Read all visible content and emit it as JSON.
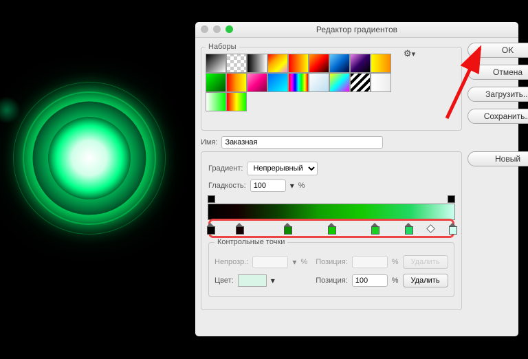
{
  "window": {
    "title": "Редактор градиентов"
  },
  "presets_label": "Наборы",
  "buttons": {
    "ok": "OK",
    "cancel": "Отмена",
    "load": "Загрузить...",
    "save": "Сохранить...",
    "new": "Новый"
  },
  "name": {
    "label": "Имя:",
    "value": "Заказная"
  },
  "gradient": {
    "type_label": "Градиент:",
    "type_value": "Непрерывный",
    "smooth_label": "Гладкость:",
    "smooth_value": "100",
    "chart_data": {
      "type": "gradient",
      "stops": [
        {
          "pos": 0,
          "color": "#000000"
        },
        {
          "pos": 12,
          "color": "#140000"
        },
        {
          "pos": 32,
          "color": "#0f8a00"
        },
        {
          "pos": 50,
          "color": "#14c800"
        },
        {
          "pos": 68,
          "color": "#18d020"
        },
        {
          "pos": 82,
          "color": "#22d862"
        },
        {
          "pos": 100,
          "color": "#cdfef0"
        }
      ],
      "opacity_stops": [
        {
          "pos": 0,
          "opacity": 100
        },
        {
          "pos": 100,
          "opacity": 100
        }
      ]
    }
  },
  "control_points": {
    "legend": "Контрольные точки",
    "opacity_label": "Непрозр.:",
    "position_label": "Позиция:",
    "color_label": "Цвет:",
    "position_value": "100",
    "delete": "Удалить",
    "selected_color": "#d9f5e8"
  },
  "percent": "%",
  "preset_gradients": [
    "linear-gradient(135deg,#000,#fff)",
    "repeating-conic-gradient(#ccc 0 25%,#fff 0 50%) 0/10px 10px",
    "linear-gradient(90deg,#000,#fff)",
    "linear-gradient(135deg,red,orange,yellow,violet)",
    "linear-gradient(90deg,red,yellow)",
    "linear-gradient(135deg,orange,red,#200)",
    "linear-gradient(135deg,#6cf,#06c,#003)",
    "linear-gradient(135deg,violet,#306,#000)",
    "linear-gradient(90deg,#ff0,#f80)",
    "linear-gradient(135deg,#0f0,#050)",
    "linear-gradient(90deg,red,orange,yellow)",
    "linear-gradient(135deg,#f8c,#f08,#804)",
    "linear-gradient(135deg,#06f,#0ff)",
    "linear-gradient(90deg,red,magenta,blue,cyan,lime,yellow,red)",
    "linear-gradient(135deg,#fff,#bde)",
    "linear-gradient(135deg,#ff0,#0ff,#f0f)",
    "repeating-linear-gradient(135deg,#000 0 4px,#fff 4px 8px)",
    "linear-gradient(90deg,#fff,transparent)",
    "linear-gradient(90deg,#fff,#0f0)",
    "linear-gradient(90deg,red,yellow,lime)"
  ]
}
